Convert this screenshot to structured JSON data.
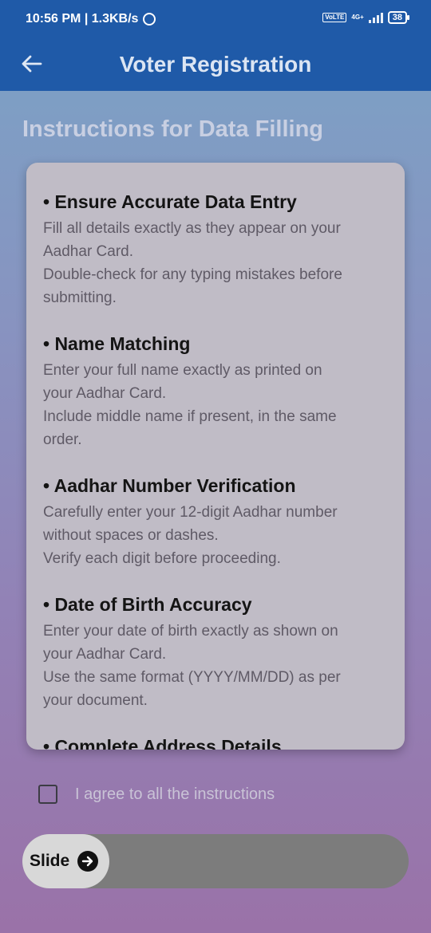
{
  "status_bar": {
    "time_speed": "10:56 PM | 1.3KB/s",
    "network_type": "4G+",
    "volte": "VoLTE",
    "battery": "38"
  },
  "app_bar": {
    "title": "Voter Registration",
    "back_icon": "arrow-left-icon"
  },
  "section_title": "Instructions for Data Filling",
  "instructions": [
    {
      "heading": "• Ensure Accurate Data Entry",
      "lines": [
        "Fill all details exactly as they appear on your",
        "Aadhar Card.",
        "Double-check for any typing mistakes before",
        "submitting."
      ]
    },
    {
      "heading": "• Name Matching",
      "lines": [
        "Enter your full name exactly as printed on",
        "your Aadhar Card.",
        "Include middle name if present, in the same",
        "order."
      ]
    },
    {
      "heading": "• Aadhar Number Verification",
      "lines": [
        "Carefully enter your 12-digit Aadhar number",
        "without spaces or dashes.",
        "Verify each digit before proceeding."
      ]
    },
    {
      "heading": "• Date of Birth Accuracy",
      "lines": [
        "Enter your date of birth exactly as shown on",
        "your Aadhar Card.",
        "Use the same format (YYYY/MM/DD) as per",
        "your document."
      ]
    },
    {
      "heading": "• Complete Address Details",
      "lines": []
    }
  ],
  "agree": {
    "label": "I agree to all the instructions",
    "checked": false
  },
  "slider": {
    "label": "Slide",
    "icon": "arrow-right-circle-icon",
    "progress": 0
  },
  "colors": {
    "app_bar": "#1f5aa8",
    "card": "#c0bcc6",
    "slider_track": "#7c7c7c",
    "slider_thumb": "#d8d8d8"
  }
}
